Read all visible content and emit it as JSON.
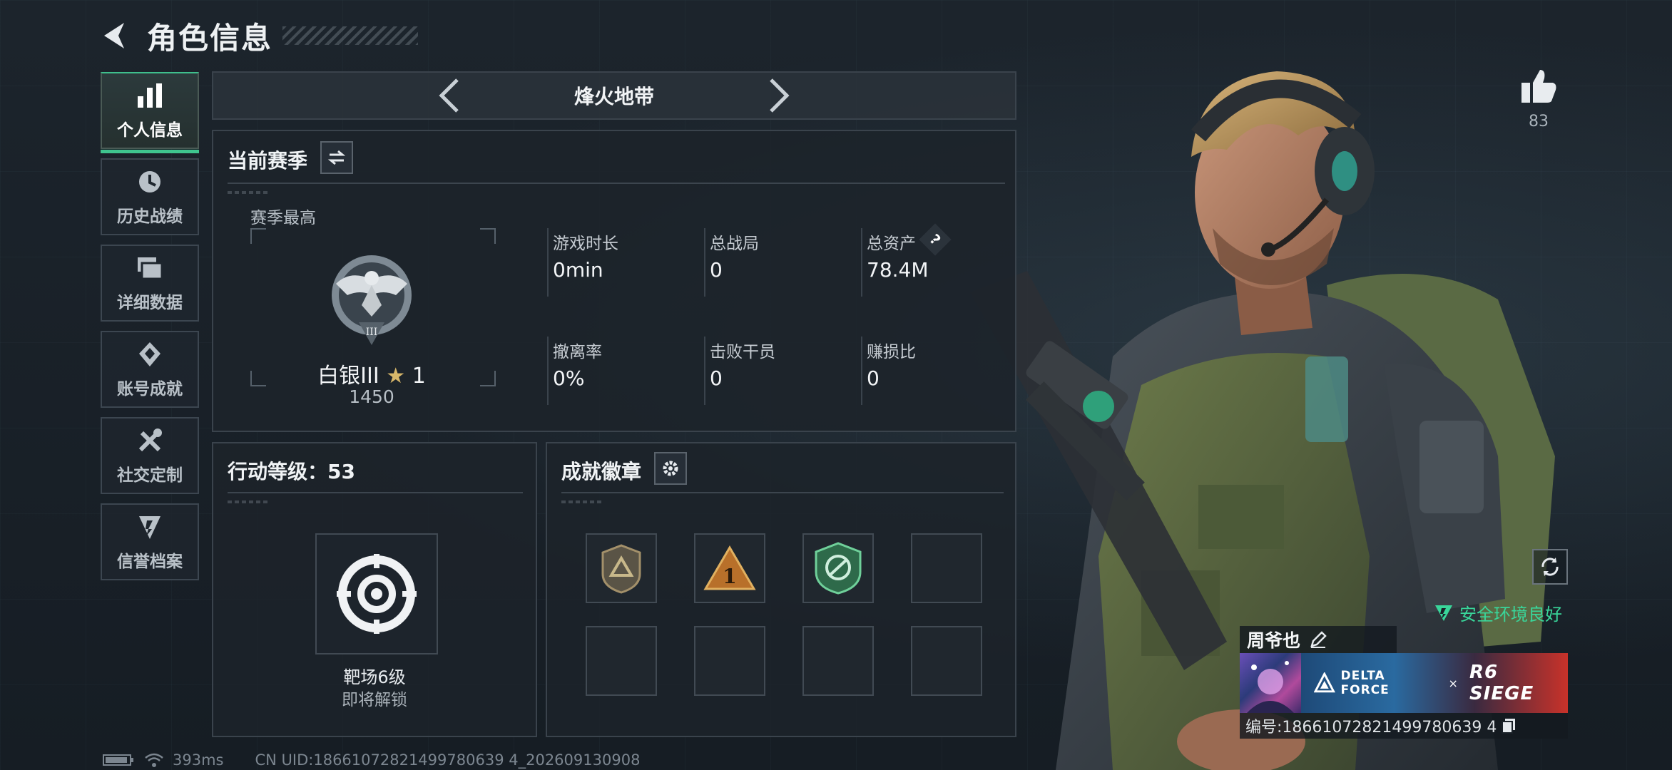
{
  "header": {
    "title": "角色信息"
  },
  "sidebar": {
    "items": [
      {
        "label": "个人信息",
        "icon": "bar-chart-icon",
        "active": true
      },
      {
        "label": "历史战绩",
        "icon": "history-clock-icon",
        "active": false
      },
      {
        "label": "详细数据",
        "icon": "folder-stack-icon",
        "active": false
      },
      {
        "label": "账号成就",
        "icon": "achievement-diamond-icon",
        "active": false
      },
      {
        "label": "社交定制",
        "icon": "tools-icon",
        "active": false
      },
      {
        "label": "信誉档案",
        "icon": "reputation-shield-icon",
        "active": false
      }
    ]
  },
  "mode_switch": {
    "title": "烽火地带"
  },
  "season": {
    "title": "当前赛季",
    "best_label": "赛季最高",
    "rank_name": "白银III",
    "rank_stars": "1",
    "rank_points": "1450",
    "rank_emblem_numeral": "III",
    "stats": [
      {
        "label": "游戏时长",
        "value": "0min"
      },
      {
        "label": "总战局",
        "value": "0"
      },
      {
        "label": "总资产",
        "value": "78.4M",
        "help": "?"
      },
      {
        "label": "撤离率",
        "value": "0%"
      },
      {
        "label": "击败干员",
        "value": "0"
      },
      {
        "label": "赚损比",
        "value": "0"
      }
    ]
  },
  "action_level": {
    "title": "行动等级：53",
    "item_name": "靶场6级",
    "item_status": "即将解锁"
  },
  "achievements": {
    "title": "成就徽章",
    "badges": [
      "badge-shield-a",
      "badge-triangle-1",
      "badge-green-emblem"
    ]
  },
  "profile": {
    "like_count": "83",
    "safety_status": "安全环境良好",
    "player_name": "周爷也",
    "collab_left": "DELTA FORCE",
    "collab_x": "×",
    "collab_right": "R6 SIEGE",
    "uid_line": "编号:18661072821499780639 4"
  },
  "footer": {
    "ping": "393ms",
    "uid": "CN UID:18661072821499780639 4_202609130908"
  },
  "colors": {
    "accent": "#3fc48e",
    "safe": "#39d69a",
    "panel": "#1c232a"
  }
}
